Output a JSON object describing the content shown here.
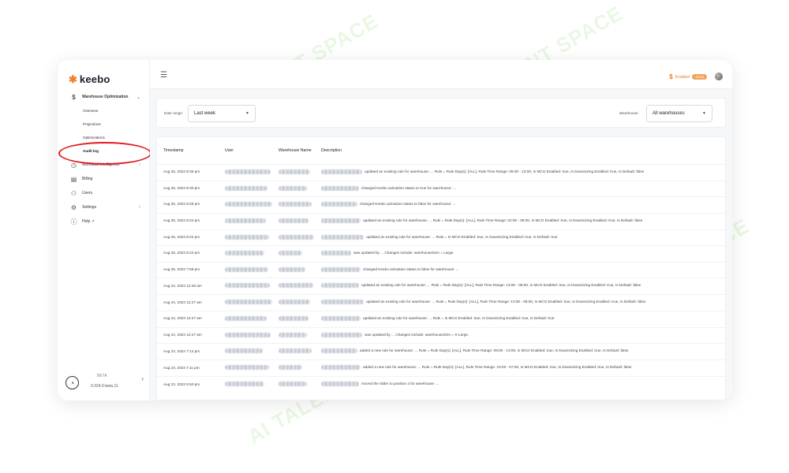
{
  "app": {
    "logo_text": "keebo"
  },
  "sidebar": {
    "groups": [
      {
        "label": "Warehouse Optimization",
        "icon": "dollar-icon",
        "items": [
          {
            "label": "Overview"
          },
          {
            "label": "Projections"
          },
          {
            "label": "Optimizations"
          },
          {
            "label": "Audit log",
            "active": true
          }
        ]
      }
    ],
    "items": [
      {
        "label": "Workload Intelligence",
        "icon": "clock-icon"
      },
      {
        "label": "Billing",
        "icon": "billing-icon"
      },
      {
        "label": "Users",
        "icon": "users-icon"
      },
      {
        "label": "Settings",
        "icon": "gear-icon"
      },
      {
        "label": "Help ↗",
        "icon": "help-icon"
      }
    ],
    "footer": {
      "beta_label": "BETA",
      "version": "0.324.0-beta.11"
    }
  },
  "header": {
    "enabled_label": "Enabled",
    "enabled_badge": "11/13"
  },
  "filters": {
    "date_range_label": "Date range:",
    "date_range_value": "Last week",
    "warehouse_label": "Warehouse:",
    "warehouse_value": "All warehouses"
  },
  "table": {
    "headers": {
      "timestamp": "Timestamp",
      "user": "User",
      "warehouse": "Warehouse Name",
      "description": "Description"
    },
    "rows": [
      {
        "timestamp": "Aug 25, 2023 8:36 pm",
        "description": "updated an existing rule for warehouse: ... Rule = Rule Day(s): [ALL], Rule Time Range: 09:00 - 13:00, Is MCO Enabled: true, Is Downsizing Enabled: true, Is Default: false"
      },
      {
        "timestamp": "Aug 25, 2023 8:30 pm",
        "description": "changed Keebo activation status to true for warehouse: ..."
      },
      {
        "timestamp": "Aug 25, 2023 8:29 pm",
        "description": "changed Keebo activation status to false for warehouse: ..."
      },
      {
        "timestamp": "Aug 25, 2023 8:22 pm",
        "description": "updated an existing rule for warehouse: ... Rule = Rule Day(s): [ALL], Rule Time Range: 02:00 - 09:00, Is MCO Enabled: true, Is Downsizing Enabled: true, Is Default: false"
      },
      {
        "timestamp": "Aug 25, 2023 8:22 pm",
        "description": "updated an existing rule for warehouse: ... Rule = Is MCO Enabled: true, Is Downsizing Enabled: true, Is Default: true"
      },
      {
        "timestamp": "Aug 25, 2023 8:22 pm",
        "description": "was updated by ... Changes include: warehouseSize = Large."
      },
      {
        "timestamp": "Aug 25, 2023 7:59 pm",
        "description": "changed Keebo activation status to false for warehouse: ..."
      },
      {
        "timestamp": "Aug 24, 2023 12:28 am",
        "description": "updated an existing rule for warehouse: ... Rule = Rule Day(s): [ALL], Rule Time Range: 13:00 - 09:00, Is MCO Enabled: true, Is Downsizing Enabled: true, Is Default: false"
      },
      {
        "timestamp": "Aug 24, 2023 12:27 am",
        "description": "updated an existing rule for warehouse: ... Rule = Rule Day(s): [ALL], Rule Time Range: 13:00 - 09:00, Is MCO Enabled: true, Is Downsizing Enabled: true, Is Default: false"
      },
      {
        "timestamp": "Aug 24, 2023 12:27 am",
        "description": "updated an existing rule for warehouse: ... Rule = Is MCO Enabled: true, Is Downsizing Enabled: true, Is Default: true"
      },
      {
        "timestamp": "Aug 24, 2023 12:27 am",
        "description": "was updated by ... Changes include: warehouseSize = X-Large."
      },
      {
        "timestamp": "Aug 23, 2023 7:14 pm",
        "description": "added a new rule for warehouse: ... Rule = Rule Day(s): [ALL], Rule Time Range: 09:00 - 13:00, Is MCO Enabled: true, Is Downsizing Enabled: true, Is Default: false"
      },
      {
        "timestamp": "Aug 23, 2023 7:11 pm",
        "description": "added a new rule for warehouse: ... Rule = Rule Day(s): [ALL], Rule Time Range: 23:00 - 07:00, Is MCO Enabled: true, Is Downsizing Enabled: true, Is Default: false"
      },
      {
        "timestamp": "Aug 23, 2023 6:50 pm",
        "description": "moved the slider to position 4 for warehouse: ..."
      }
    ]
  },
  "watermark": {
    "text": "AI TALENT SPACE"
  },
  "colors": {
    "accent": "#ee7e2a",
    "annotation": "#e01b22"
  }
}
